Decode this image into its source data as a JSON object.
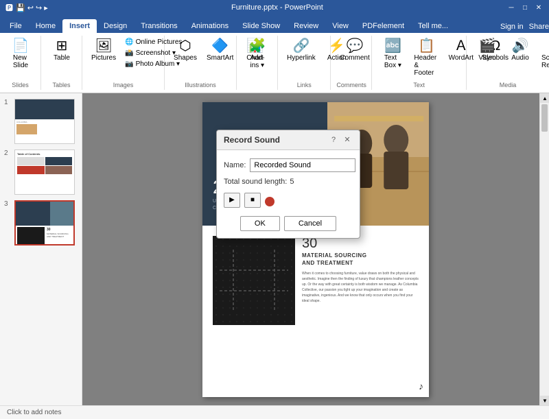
{
  "titlebar": {
    "title": "Furniture.pptx - PowerPoint",
    "min": "─",
    "max": "□",
    "close": "✕"
  },
  "tabs": [
    "File",
    "Home",
    "Insert",
    "Design",
    "Transitions",
    "Animations",
    "Slide Show",
    "Review",
    "View",
    "PDFelement",
    "Tell me..."
  ],
  "active_tab": "Insert",
  "ribbon": {
    "groups": [
      {
        "label": "Slides",
        "items_label": "New Slide"
      },
      {
        "label": "Tables",
        "items_label": "Table"
      },
      {
        "label": "Images",
        "items": [
          "Pictures",
          "Online Pictures",
          "Screenshot",
          "Photo Album",
          "Shapes",
          "SmartArt",
          "Chart"
        ]
      },
      {
        "label": "Illustrations"
      },
      {
        "label": "Links",
        "items": [
          "Hyperlink",
          "Action"
        ]
      },
      {
        "label": "Comments",
        "items": [
          "Comment"
        ]
      },
      {
        "label": "Text",
        "items": [
          "Text Box",
          "Header & Footer",
          "WordArt",
          "Symbols"
        ]
      },
      {
        "label": "Media",
        "items": [
          "Video",
          "Audio",
          "Screen Recording"
        ]
      }
    ]
  },
  "slides": [
    {
      "num": "1"
    },
    {
      "num": "2"
    },
    {
      "num": "3",
      "active": true
    }
  ],
  "slide": {
    "top_number": "28",
    "top_subtitle_line1": "UNCOMPROMISING",
    "top_subtitle_line2": "CRAFTSMANSHIP",
    "bottom_number": "30",
    "bottom_title_line1": "MATERIAL SOURCING",
    "bottom_title_line2": "AND TREATMENT",
    "bottom_body": "When it comes to choosing furniture, value draws on both the physical and aesthetic. Imagine then the finding of luxury that champions leather concepts up. Or the way with great certainty is both wisdom we manage.\n\nAs Columbia Collective, our passion you light up your imagination and create as imaginative, ingenious. And we know that only occurs when you find your ideal shape."
  },
  "dialog": {
    "title": "Record Sound",
    "help_icon": "?",
    "close_icon": "✕",
    "name_label": "Name:",
    "name_value": "Recorded Sound",
    "length_label": "Total sound length:",
    "length_value": "5",
    "play_label": "▶",
    "stop_label": "■",
    "ok_label": "OK",
    "cancel_label": "Cancel"
  },
  "statusbar": {
    "text": "Click to add notes"
  }
}
